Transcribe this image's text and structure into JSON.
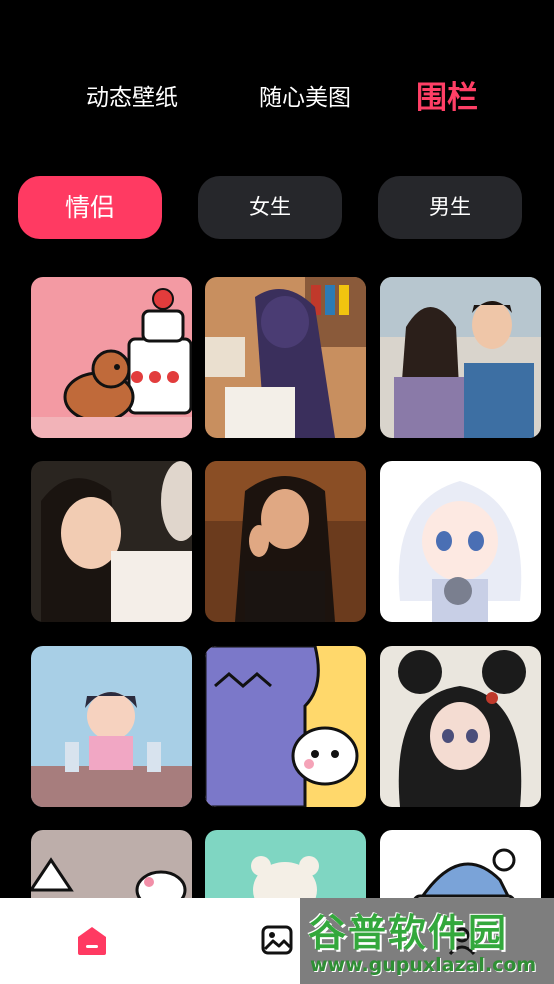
{
  "top_tabs": [
    "动态壁纸",
    "随心美图",
    "围栏"
  ],
  "active_top_tab": "围栏",
  "chips": [
    "情侣",
    "女生",
    "男生"
  ],
  "active_chip": "情侣",
  "colors": {
    "accent": "#ff3a62",
    "background": "#000000",
    "chip_inactive": "#26272b",
    "nav_background": "#ffffff"
  },
  "grid": {
    "items": [
      {
        "name": "cake-puppy-wallpaper"
      },
      {
        "name": "anime-girl-reading-wallpaper"
      },
      {
        "name": "couple-photo-wallpaper"
      },
      {
        "name": "smiling-girl-photo-wallpaper"
      },
      {
        "name": "woman-portrait-wallpaper"
      },
      {
        "name": "anime-white-hair-girl-wallpaper"
      },
      {
        "name": "cartoon-boy-wallpaper"
      },
      {
        "name": "purple-monster-rabbit-wallpaper"
      },
      {
        "name": "mouse-ears-girl-wallpaper"
      },
      {
        "name": "cartoon-cat-wallpaper"
      },
      {
        "name": "bear-figure-wallpaper"
      },
      {
        "name": "sleepy-hat-wallpaper"
      }
    ]
  },
  "bottom_nav": {
    "items": [
      {
        "icon": "home-icon",
        "active": true
      },
      {
        "icon": "gallery-icon",
        "active": false
      },
      {
        "icon": "profile-icon",
        "active": false
      }
    ]
  },
  "watermark": {
    "title": "谷普软件园",
    "url": "www.gupuxlazal.com"
  }
}
